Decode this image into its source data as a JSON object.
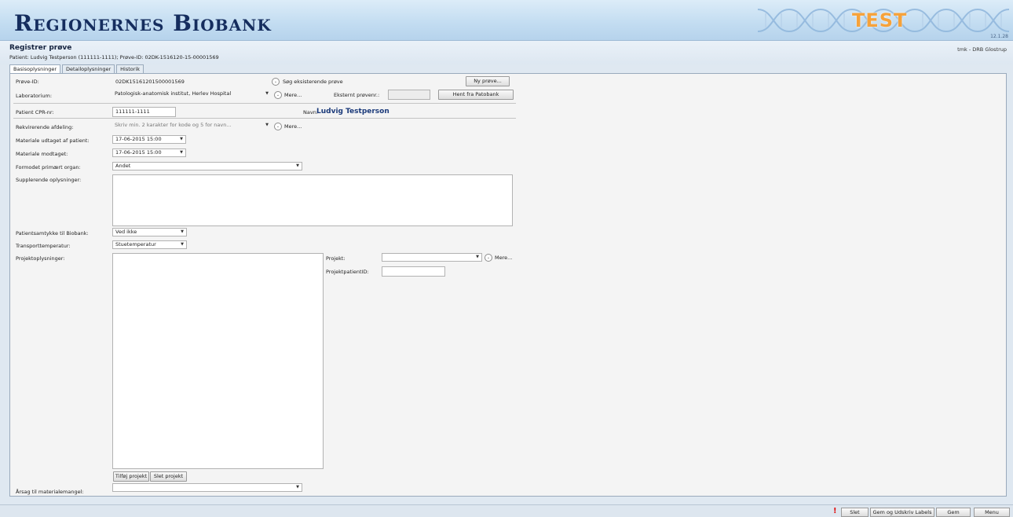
{
  "banner": {
    "app_title": "Regionernes Biobank",
    "test_label": "TEST",
    "version": "12.1.28"
  },
  "header": {
    "page_title": "Registrer prøve",
    "subtitle": "Patient: Ludvig Testperson (111111-1111); Prøve-ID: 02DK-1516120-15-00001569",
    "user_info": "tmk - DRB Glostrup"
  },
  "tabs": [
    "Basisoplysninger",
    "Detailoplysninger",
    "Historik"
  ],
  "form": {
    "prove_id_label": "Prøve-ID:",
    "prove_id_value": "02DK15161201500001569",
    "search_existing": "Søg eksisterende prøve",
    "new_sample_button": "Ny prøve...",
    "laboratory_label": "Laboratorium:",
    "laboratory_value": "Patologisk-anatomisk institut, Herlev Hospital",
    "more": "Mere...",
    "external_sample_label": "Eksternt prøvenr.:",
    "fetch_patobank_button": "Hent fra Patobank",
    "cpr_label": "Patient CPR-nr:",
    "cpr_value": "111111-1111",
    "name_label": "Navn:",
    "name_value": "Ludvig Testperson",
    "requesting_dept_label": "Rekvirerende afdeling:",
    "requesting_dept_placeholder": "Skriv min. 2 karakter for kode og 5 for navn...",
    "material_taken_label": "Materiale udtaget af patient:",
    "material_taken_value": "17-06-2015 15:00",
    "material_received_label": "Materiale modtaget:",
    "material_received_value": "17-06-2015 15:00",
    "organ_label": "Formodet primært organ:",
    "organ_value": "Andet",
    "supplementary_label": "Supplerende oplysninger:",
    "consent_label": "Patientsamtykke til Biobank:",
    "consent_value": "Ved ikke",
    "transport_label": "Transporttemperatur:",
    "transport_value": "Stuetemperatur",
    "project_info_label": "Projektoplysninger:",
    "project_label": "Projekt:",
    "project_patient_id_label": "ProjektpatientID:",
    "add_project_button": "Tilføj projekt",
    "delete_project_button": "Slet projekt",
    "shortage_reason_label": "Årsag til materialemangel:"
  },
  "footer": {
    "warning": "!",
    "delete_button": "Slet",
    "save_print_button": "Gem og Udskriv Labels",
    "save_button": "Gem",
    "menu_button": "Menu"
  },
  "colors": {
    "banner_title": "#152d5e",
    "test_badge": "#f6a23a",
    "name_value": "#1b3a7a",
    "warning": "#e01010"
  }
}
